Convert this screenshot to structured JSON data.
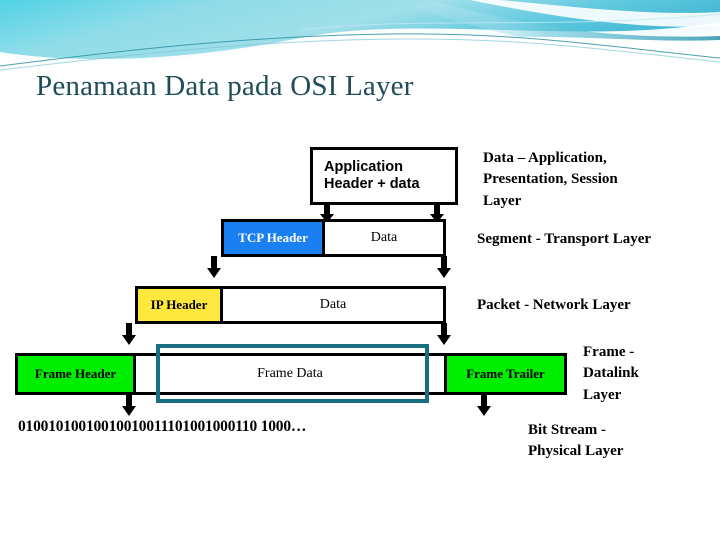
{
  "slide": {
    "title": "Penamaan Data pada OSI Layer",
    "title_color": "#1f4e5a",
    "background": "#ffffff"
  },
  "header_decoration": {
    "name": "teal-wave-banner",
    "colors": [
      "#5ad6e4",
      "#7fd4e0",
      "#2e9fb5",
      "#1a6e81",
      "#bfe9f2",
      "#ffffff"
    ]
  },
  "diagram": {
    "name": "osi-encapsulation-diagram",
    "rows": [
      {
        "id": "application",
        "cells": [
          {
            "label": "Application\nHeader + data",
            "fill": "#ffffff",
            "text_color": "#000000"
          }
        ]
      },
      {
        "id": "transport",
        "cells": [
          {
            "label": "TCP Header",
            "fill": "#1a7ff0",
            "text_color": "#ffffff"
          },
          {
            "label": "Data",
            "fill": "#ffffff",
            "text_color": "#000000"
          }
        ]
      },
      {
        "id": "network",
        "cells": [
          {
            "label": "IP Header",
            "fill": "#ffe83d",
            "text_color": "#000000"
          },
          {
            "label": "Data",
            "fill": "#ffffff",
            "text_color": "#000000"
          }
        ]
      },
      {
        "id": "datalink",
        "cells": [
          {
            "label": "Frame Header",
            "fill": "#00ee00",
            "text_color": "#000000"
          },
          {
            "label": "Frame Data",
            "fill": "#ffffff",
            "text_color": "#000000"
          },
          {
            "label": "Frame Trailer",
            "fill": "#00ee00",
            "text_color": "#000000"
          }
        ]
      }
    ],
    "highlight": {
      "name": "frame-data-highlight",
      "color": "#1a6e81"
    },
    "bit_stream": "01001010010010010011101001000110 1000…"
  },
  "side_labels": [
    {
      "id": "application",
      "text": "Data – Application,\nPresentation, Session\nLayer"
    },
    {
      "id": "transport",
      "text": "Segment - Transport Layer"
    },
    {
      "id": "network",
      "text": "Packet - Network Layer"
    },
    {
      "id": "datalink",
      "text": "Frame -\nDatalink\nLayer"
    },
    {
      "id": "physical",
      "text": "Bit Stream -\nPhysical Layer"
    }
  ]
}
